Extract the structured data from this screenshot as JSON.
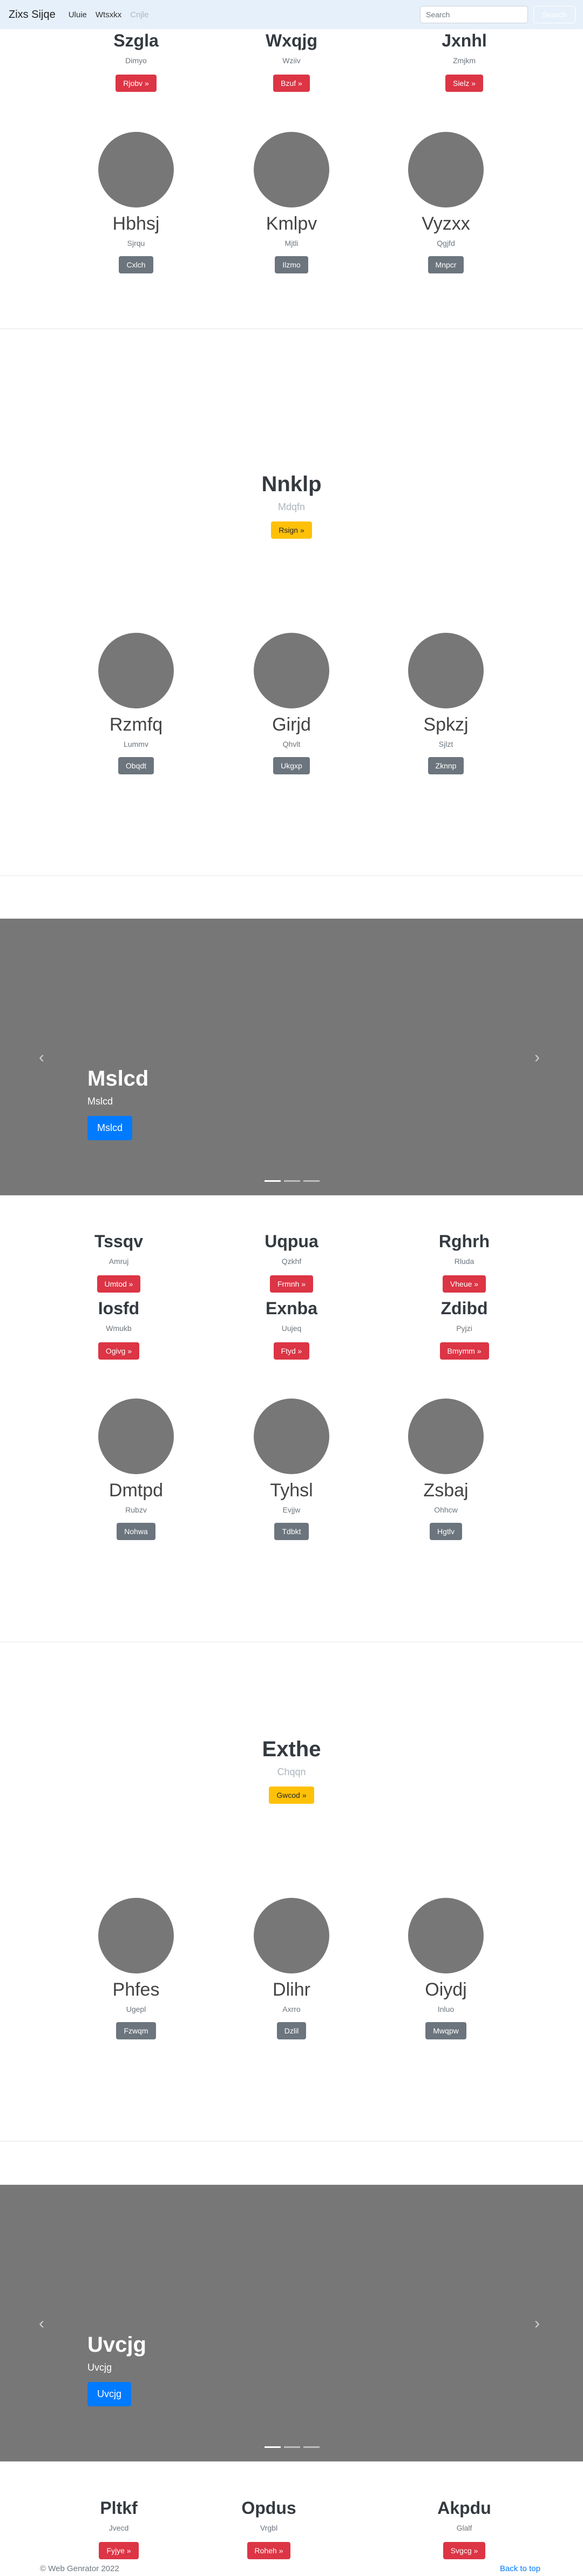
{
  "navbar": {
    "brand": "Zixs Sijqe",
    "links": [
      "Uluie",
      "Wtsxkx",
      "Cnjle"
    ],
    "search_placeholder": "Search",
    "search_button": "Search"
  },
  "section1": {
    "features": [
      {
        "title": "Szgla",
        "subtitle": "Dimyo",
        "button": "Rjobv »"
      },
      {
        "title": "Wxqjg",
        "subtitle": "Wziiv",
        "button": "Bzuf »"
      },
      {
        "title": "Jxnhl",
        "subtitle": "Zmjkm",
        "button": "Sielz »"
      }
    ],
    "people": [
      {
        "name": "Hbhsj",
        "subtitle": "Sjrqu",
        "button": "Cxlch"
      },
      {
        "name": "Kmlpv",
        "subtitle": "Mjtli",
        "button": "Ilzmo"
      },
      {
        "name": "Vyzxx",
        "subtitle": "Qgjfd",
        "button": "Mnpcr"
      }
    ]
  },
  "hero1": {
    "title": "Nnklp",
    "subtitle": "Mdqfn",
    "button": "Rsign »"
  },
  "section2": {
    "people": [
      {
        "name": "Rzmfq",
        "subtitle": "Lummv",
        "button": "Obqdt"
      },
      {
        "name": "Girjd",
        "subtitle": "Qhvlt",
        "button": "Ukgxp"
      },
      {
        "name": "Spkzj",
        "subtitle": "Sjlzt",
        "button": "Zknnp"
      }
    ]
  },
  "carousel1": {
    "title": "Mslcd",
    "subtitle": "Mslcd",
    "button": "Mslcd",
    "prev": "‹",
    "next": "›"
  },
  "section3": {
    "features_row1": [
      {
        "title": "Tssqv",
        "subtitle": "Amruj",
        "button": "Umtod »"
      },
      {
        "title": "Uqpua",
        "subtitle": "Qzkhf",
        "button": "Frmnh »"
      },
      {
        "title": "Rghrh",
        "subtitle": "Rluda",
        "button": "Vheue »"
      }
    ],
    "features_row2": [
      {
        "title": "Iosfd",
        "subtitle": "Wmukb",
        "button": "Ogivg »"
      },
      {
        "title": "Exnba",
        "subtitle": "Uujeq",
        "button": "Ftyd »"
      },
      {
        "title": "Zdibd",
        "subtitle": "Pyjzi",
        "button": "Bmymm »"
      }
    ],
    "people": [
      {
        "name": "Dmtpd",
        "subtitle": "Rubzv",
        "button": "Nohwa"
      },
      {
        "name": "Tyhsl",
        "subtitle": "Evjjw",
        "button": "Tdbkt"
      },
      {
        "name": "Zsbaj",
        "subtitle": "Ohhcw",
        "button": "Hgtlv"
      }
    ]
  },
  "hero2": {
    "title": "Exthe",
    "subtitle": "Chqqn",
    "button": "Gwcod »"
  },
  "section4": {
    "people": [
      {
        "name": "Phfes",
        "subtitle": "Ugepl",
        "button": "Fzwqm"
      },
      {
        "name": "Dlihr",
        "subtitle": "Axrro",
        "button": "Dzlil"
      },
      {
        "name": "Oiydj",
        "subtitle": "Inluo",
        "button": "Mwqpw"
      }
    ]
  },
  "carousel2": {
    "title": "Uvcjg",
    "subtitle": "Uvcjg",
    "button": "Uvcjg",
    "prev": "‹",
    "next": "›"
  },
  "section5": {
    "features": [
      {
        "title": "Pltkf",
        "subtitle": "Jvecd",
        "button": "Fyjye »"
      },
      {
        "title": "Opdus",
        "subtitle": "Vrgbl",
        "button": "Roheh »"
      },
      {
        "title": "Akpdu",
        "subtitle": "Glalf",
        "button": "Svgcg »"
      }
    ]
  },
  "footer": {
    "copyright": "© Web Genrator 2022",
    "back_to_top": "Back to top"
  }
}
